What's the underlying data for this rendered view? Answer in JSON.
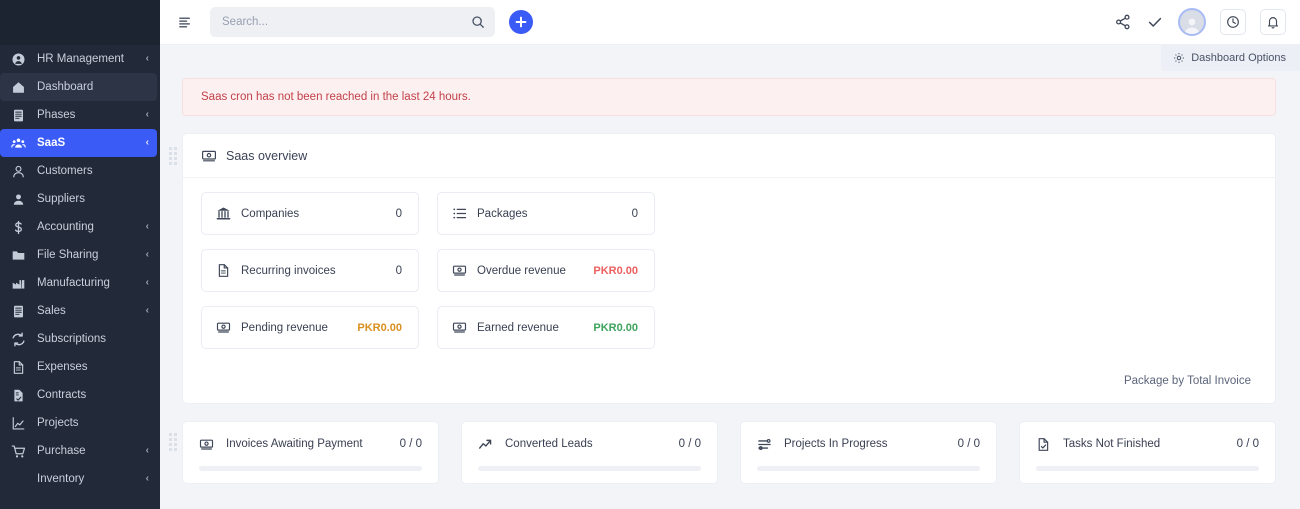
{
  "sidebar": {
    "items": [
      {
        "label": "HR Management",
        "icon": "user-circle-icon",
        "chevron": "‹",
        "state": "normal"
      },
      {
        "label": "Dashboard",
        "icon": "home-icon",
        "chevron": "",
        "state": "hovered"
      },
      {
        "label": "Phases",
        "icon": "list-doc-icon",
        "chevron": "‹",
        "state": "normal"
      },
      {
        "label": "SaaS",
        "icon": "users-group-icon",
        "chevron": "‹",
        "state": "active"
      },
      {
        "label": "Customers",
        "icon": "user-outline-icon",
        "chevron": "",
        "state": "normal"
      },
      {
        "label": "Suppliers",
        "icon": "user-filled-icon",
        "chevron": "",
        "state": "normal"
      },
      {
        "label": "Accounting",
        "icon": "dollar-icon",
        "chevron": "‹",
        "state": "normal"
      },
      {
        "label": "File Sharing",
        "icon": "folder-icon",
        "chevron": "‹",
        "state": "normal"
      },
      {
        "label": "Manufacturing",
        "icon": "factory-icon",
        "chevron": "‹",
        "state": "normal"
      },
      {
        "label": "Sales",
        "icon": "list-doc-icon",
        "chevron": "‹",
        "state": "normal"
      },
      {
        "label": "Subscriptions",
        "icon": "refresh-cycle-icon",
        "chevron": "",
        "state": "normal"
      },
      {
        "label": "Expenses",
        "icon": "document-icon",
        "chevron": "",
        "state": "normal"
      },
      {
        "label": "Contracts",
        "icon": "contract-icon",
        "chevron": "",
        "state": "normal"
      },
      {
        "label": "Projects",
        "icon": "chart-icon",
        "chevron": "",
        "state": "normal"
      },
      {
        "label": "Purchase",
        "icon": "cart-icon",
        "chevron": "‹",
        "state": "normal"
      },
      {
        "label": "Inventory",
        "icon": "",
        "chevron": "‹",
        "state": "normal"
      }
    ],
    "active_color": "#3b5bf6",
    "background_color": "#222938"
  },
  "topbar": {
    "menu_icon": "align-left-icon",
    "search": {
      "placeholder": "Search...",
      "value": "",
      "icon": "search-icon"
    },
    "add_button_icon": "plus-icon",
    "right_icons": [
      "share-icon",
      "check-icon",
      "avatar",
      "clock-icon",
      "bell-icon"
    ]
  },
  "dashboard_options": {
    "label": "Dashboard Options",
    "icon": "gear-icon"
  },
  "alert": {
    "message": "Saas cron has not been reached in the last 24 hours.",
    "color": "#c2414a",
    "background": "#fdf0f0"
  },
  "saas_overview": {
    "title": "Saas overview",
    "icon": "banknote-icon",
    "cards": [
      {
        "label": "Companies",
        "icon": "bank-icon",
        "value": "0",
        "tone": "plain"
      },
      {
        "label": "Packages",
        "icon": "list-icon",
        "value": "0",
        "tone": "plain"
      },
      {
        "label": "Recurring invoices",
        "icon": "document-icon",
        "value": "0",
        "tone": "plain"
      },
      {
        "label": "Overdue revenue",
        "icon": "banknote-icon",
        "value": "PKR0.00",
        "tone": "red"
      },
      {
        "label": "Pending revenue",
        "icon": "banknote-icon",
        "value": "PKR0.00",
        "tone": "orange"
      },
      {
        "label": "Earned revenue",
        "icon": "banknote-icon",
        "value": "PKR0.00",
        "tone": "green"
      }
    ],
    "footer_note": "Package by Total Invoice",
    "colors": {
      "red": "#ed5f5f",
      "orange": "#d89020",
      "green": "#3ca45c"
    }
  },
  "bottom_cards": [
    {
      "label": "Invoices Awaiting Payment",
      "icon": "banknote-icon",
      "value": "0 / 0"
    },
    {
      "label": "Converted Leads",
      "icon": "trend-up-icon",
      "value": "0 / 0"
    },
    {
      "label": "Projects In Progress",
      "icon": "sliders-icon",
      "value": "0 / 0"
    },
    {
      "label": "Tasks Not Finished",
      "icon": "task-check-icon",
      "value": "0 / 0"
    }
  ]
}
